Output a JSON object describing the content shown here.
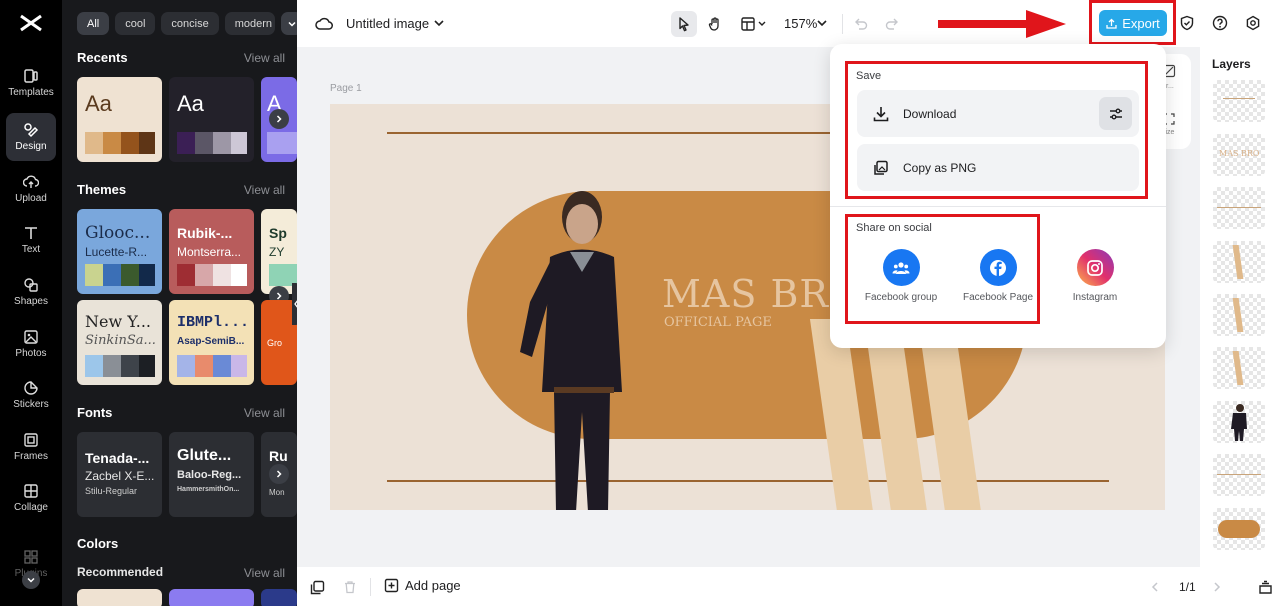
{
  "rail": {
    "items": [
      {
        "label": "Templates",
        "icon": "templates-icon"
      },
      {
        "label": "Design",
        "icon": "design-icon"
      },
      {
        "label": "Upload",
        "icon": "upload-icon"
      },
      {
        "label": "Text",
        "icon": "text-icon"
      },
      {
        "label": "Shapes",
        "icon": "shapes-icon"
      },
      {
        "label": "Photos",
        "icon": "photos-icon"
      },
      {
        "label": "Stickers",
        "icon": "stickers-icon"
      },
      {
        "label": "Frames",
        "icon": "frames-icon"
      },
      {
        "label": "Collage",
        "icon": "collage-icon"
      },
      {
        "label": "Plugins",
        "icon": "plugins-icon"
      }
    ]
  },
  "panel": {
    "chips": [
      "All",
      "cool",
      "concise",
      "modern"
    ],
    "view_all": "View all",
    "recents": {
      "title": "Recents",
      "card1_text": "Aa",
      "card2_text": "Aa",
      "card3_text": "A"
    },
    "themes": {
      "title": "Themes",
      "t1_title": "Glooc...",
      "t1_sub": "Lucette-R...",
      "t2_title": "Rubik-...",
      "t2_sub": "Montserra...",
      "t3_title": "Sp",
      "t3_sub": "ZY",
      "t4_title": "New Y...",
      "t4_sub": "SinkinSa...",
      "t5_title": "IBMPl...",
      "t5_sub": "Asap-SemiB...",
      "t6_title": "Gro"
    },
    "fonts": {
      "title": "Fonts",
      "f1_title": "Tenada-...",
      "f1_sub": "Zacbel X-E...",
      "f1_sub2": "Stilu-Regular",
      "f2_title": "Glute...",
      "f2_sub": "Baloo-Reg...",
      "f2_sub2": "HammersmithOn...",
      "f3_title": "Ru",
      "f3_sub": "Mon"
    },
    "colors": {
      "title": "Colors",
      "recommended": "Recommended"
    }
  },
  "topbar": {
    "title": "Untitled image",
    "zoom": "157%",
    "export_label": "Export"
  },
  "canvas": {
    "page_label": "Page 1",
    "brand_text": "MAS BRO",
    "brand_sub": "OFFICIAL PAGE"
  },
  "popup": {
    "save_title": "Save",
    "download_label": "Download",
    "copy_label": "Copy as PNG",
    "share_title": "Share on social",
    "social": [
      {
        "label": "Facebook group",
        "icon": "facebook-group-icon",
        "color": "#1877f2"
      },
      {
        "label": "Facebook Page",
        "icon": "facebook-icon",
        "color": "#1877f2"
      },
      {
        "label": "Instagram",
        "icon": "instagram-icon",
        "color": "#e1306c"
      }
    ],
    "side_labels": [
      "Bkgr...",
      "size"
    ]
  },
  "bottombar": {
    "add_page": "Add page",
    "page_counter": "1/1"
  },
  "layers": {
    "title": "Layers",
    "mini_text": "MAS BRO"
  },
  "colors": {
    "accent": "#27a8e8",
    "brand_orange": "#c98a45",
    "page_bg": "#ece1d6",
    "highlight_red": "#e0151b"
  }
}
